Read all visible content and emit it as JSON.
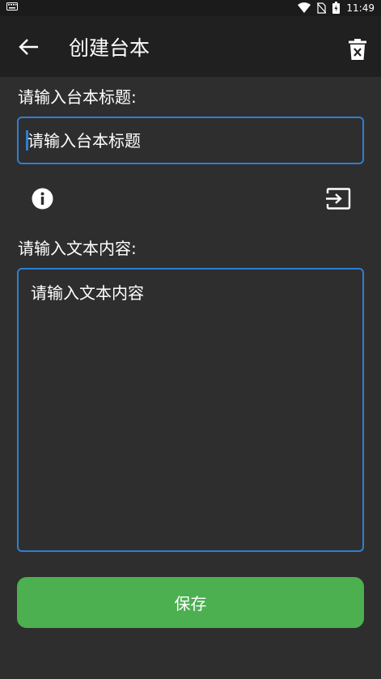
{
  "status_bar": {
    "time": "11:49",
    "icons": [
      "keyboard-icon",
      "wifi-icon",
      "no-sim-icon",
      "battery-icon"
    ]
  },
  "app_bar": {
    "title": "创建台本",
    "back_icon": "arrow-left-icon",
    "delete_icon": "trash-icon"
  },
  "form": {
    "title_label": "请输入台本标题:",
    "title_placeholder": "请输入台本标题",
    "content_label": "请输入文本内容:",
    "content_placeholder": "请输入文本内容",
    "info_icon": "info-icon",
    "input_icon": "input-icon",
    "save_label": "保存"
  },
  "colors": {
    "background": "#2e2e2e",
    "app_bar": "#202020",
    "status_bar": "#1b1b1b",
    "accent_border": "#2e7fd1",
    "save_button": "#4caf50"
  }
}
